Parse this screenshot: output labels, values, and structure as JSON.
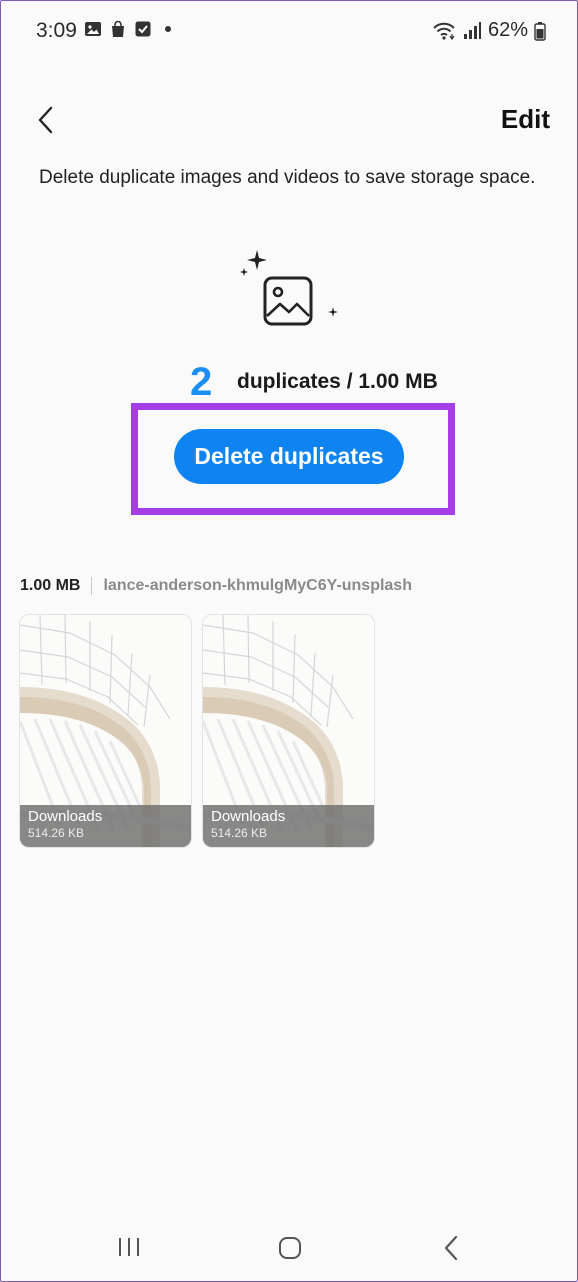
{
  "status_bar": {
    "time": "3:09",
    "battery": "62%",
    "left_icons": [
      "gallery-icon",
      "shopping-bag-icon",
      "checkbox-icon",
      "dot-icon"
    ],
    "right_icons": [
      "wifi-icon",
      "signal-icon",
      "battery-icon"
    ]
  },
  "header": {
    "back_icon": "chevron-left-icon",
    "edit_label": "Edit"
  },
  "description": "Delete duplicate images and videos to save storage space.",
  "summary": {
    "count": "2",
    "text": "duplicates / 1.00 MB"
  },
  "action": {
    "delete_label": "Delete duplicates"
  },
  "groups": [
    {
      "size": "1.00 MB",
      "name": "lance-anderson-khmulgMyC6Y-unsplash",
      "items": [
        {
          "folder": "Downloads",
          "size": "514.26 KB"
        },
        {
          "folder": "Downloads",
          "size": "514.26 KB"
        }
      ]
    }
  ],
  "colors": {
    "accent": "#0e84f2",
    "count": "#1c8ef2",
    "highlight": "#a53ee6"
  }
}
